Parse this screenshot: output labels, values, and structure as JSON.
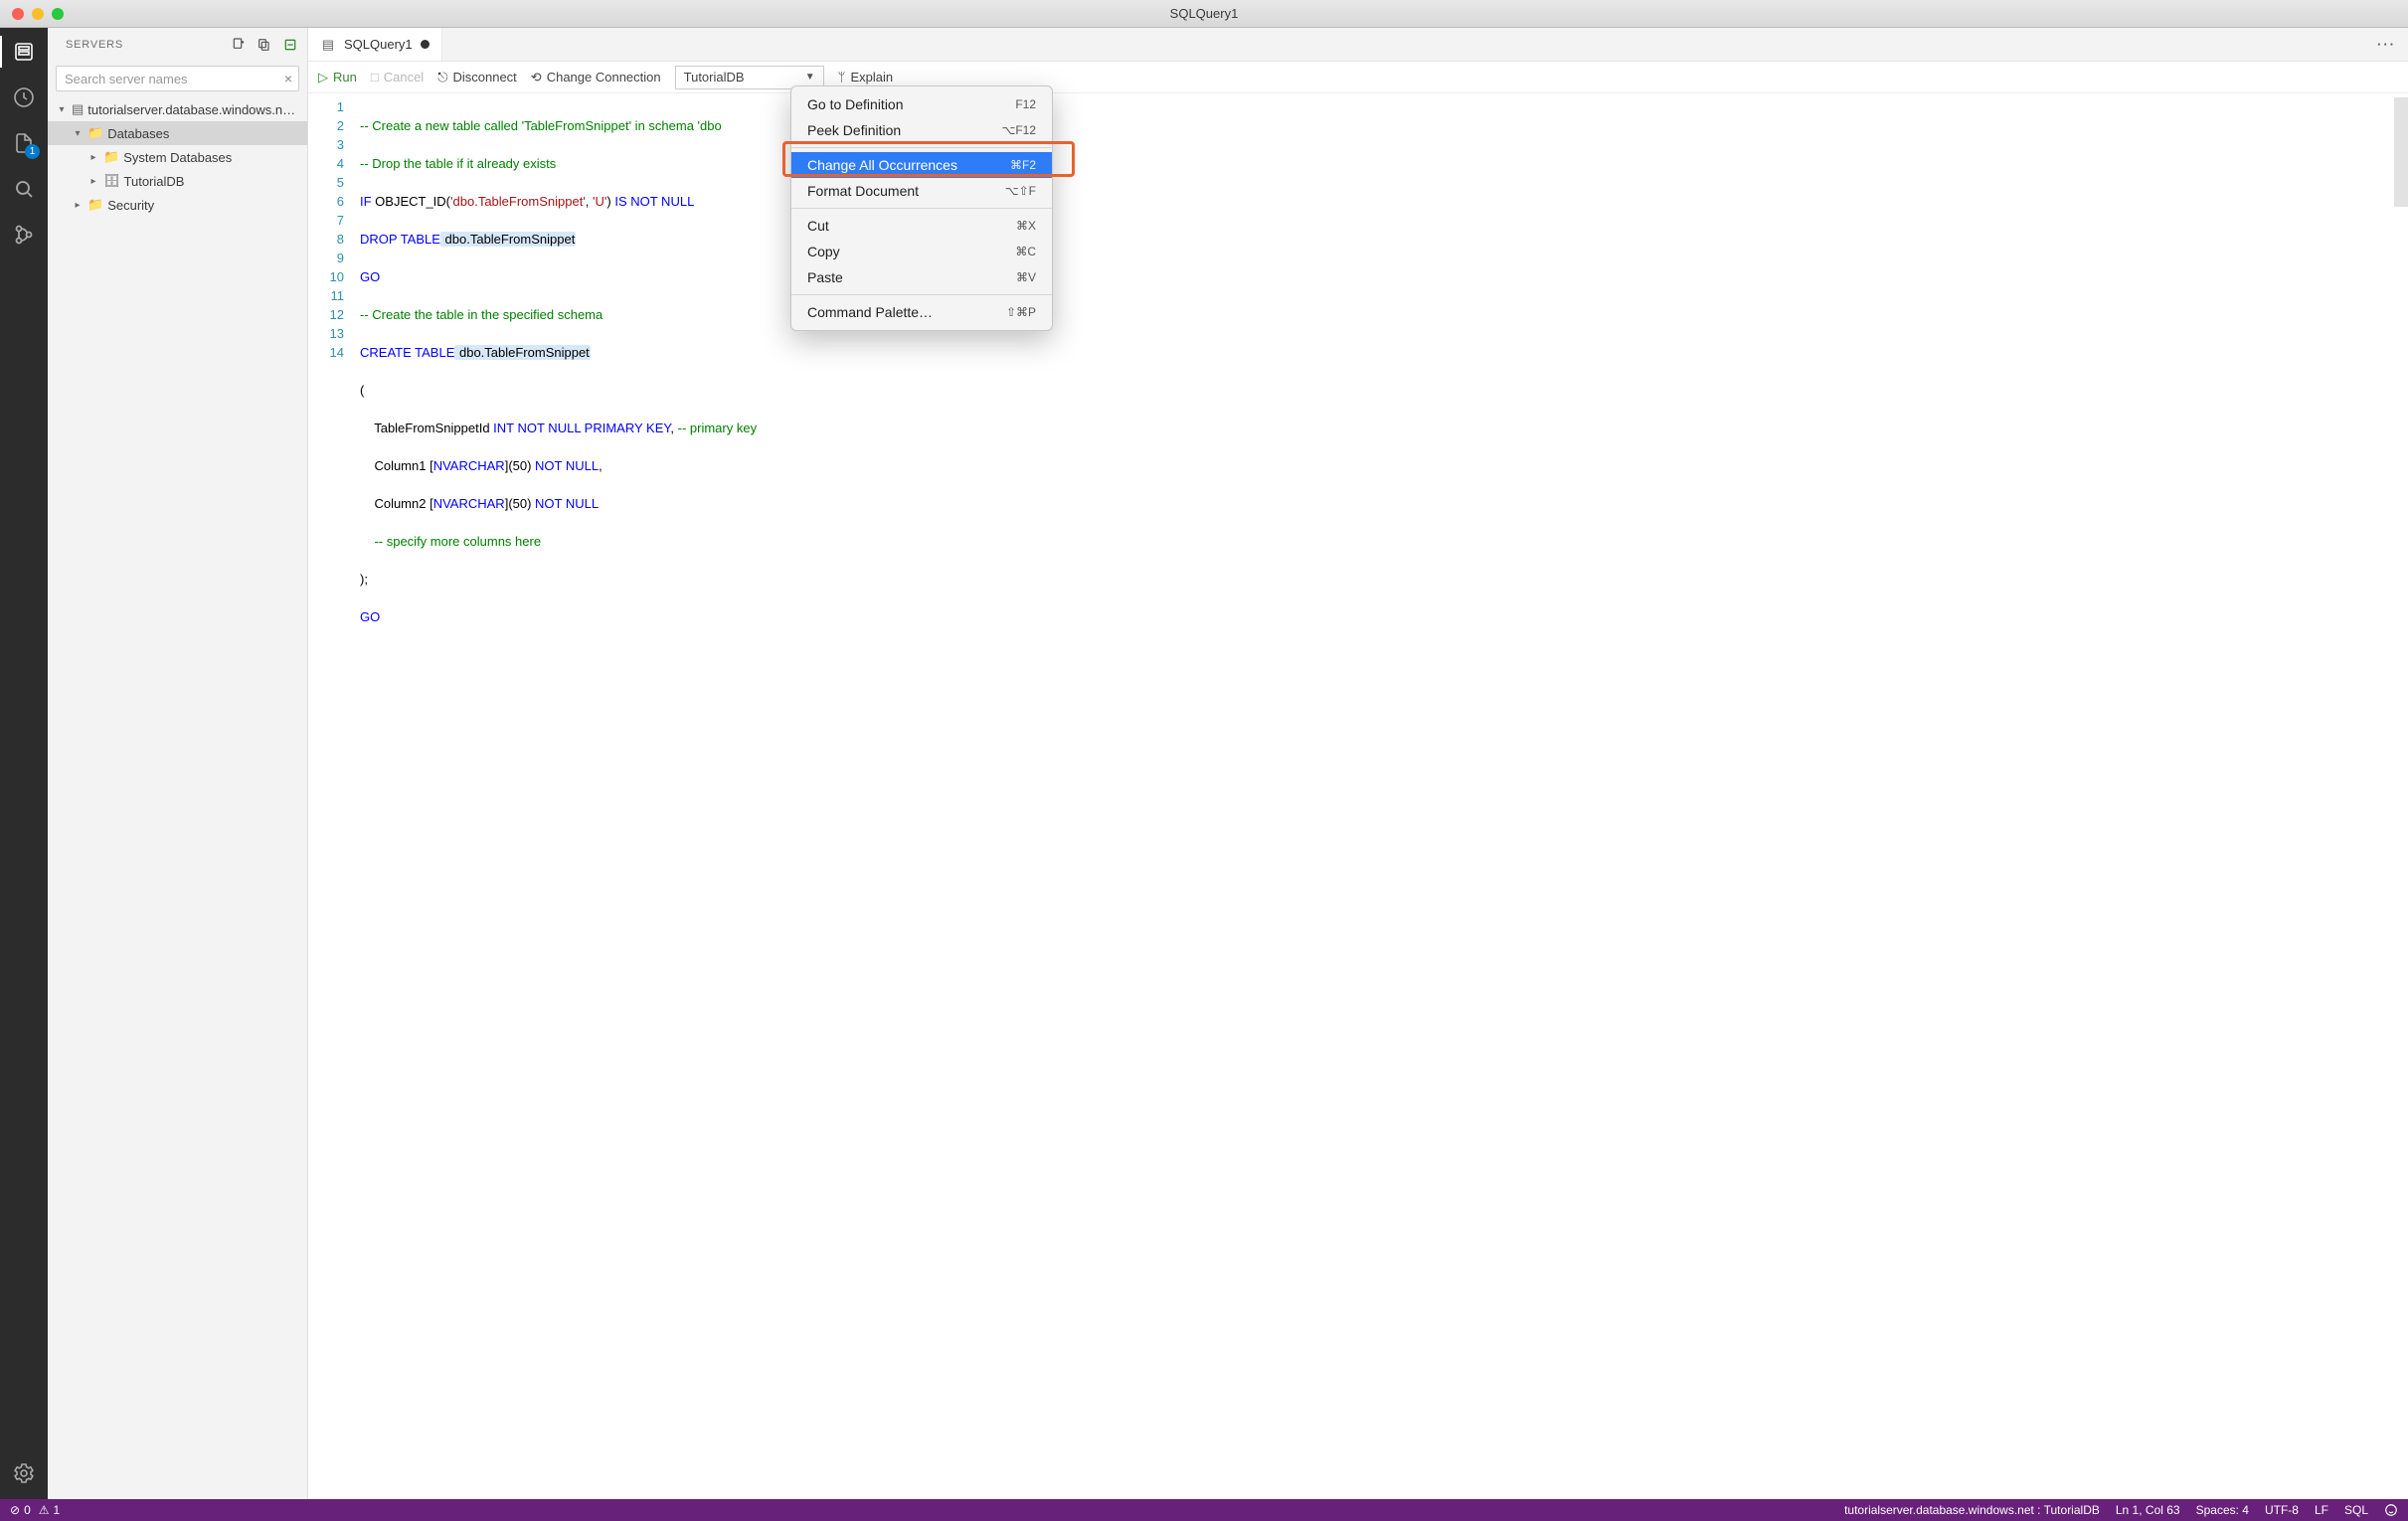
{
  "window": {
    "title": "SQLQuery1"
  },
  "sidebar": {
    "title": "SERVERS",
    "search_placeholder": "Search server names",
    "tree": {
      "server": "tutorialserver.database.windows.n…",
      "databases": "Databases",
      "sysdb": "System Databases",
      "tutorialdb": "TutorialDB",
      "security": "Security"
    }
  },
  "activity": {
    "badge": "1"
  },
  "tabs": {
    "file": "SQLQuery1"
  },
  "toolbar": {
    "run": "Run",
    "cancel": "Cancel",
    "disconnect": "Disconnect",
    "change_conn": "Change Connection",
    "db_selected": "TutorialDB",
    "explain": "Explain"
  },
  "code": {
    "lines": [
      "1",
      "2",
      "3",
      "4",
      "5",
      "6",
      "7",
      "8",
      "9",
      "10",
      "11",
      "12",
      "13",
      "14"
    ],
    "l1_a": "-- Create a new table called ",
    "l1_b": "'TableFromSnippet'",
    "l1_c": " in schema ",
    "l1_d": "'dbo",
    "l2": "-- Drop the table if it already exists",
    "l3_if": "IF",
    "l3_fn": " OBJECT_ID(",
    "l3_s1": "'dbo.TableFromSnippet'",
    "l3_cm": ", ",
    "l3_s2": "'U'",
    "l3_p2": ") ",
    "l3_kw2": "IS NOT NULL",
    "l4_kw": "DROP TABLE",
    "l4_id": " dbo.TableFromSnippet",
    "l5": "GO",
    "l6": "-- Create the table in the specified schema",
    "l7_kw": "CREATE TABLE",
    "l7_id": " dbo.TableFromSnippet",
    "l8": "(",
    "l9_a": "    TableFromSnippetId ",
    "l9_kw": "INT NOT NULL PRIMARY KEY",
    "l9_b": ", ",
    "l9_c": "-- primary key",
    "l10_a": "    Column1 [",
    "l10_kw": "NVARCHAR",
    "l10_b": "](50) ",
    "l10_kw2": "NOT NULL",
    "l10_c": ",",
    "l11_a": "    Column2 [",
    "l11_kw": "NVARCHAR",
    "l11_b": "](50) ",
    "l11_kw2": "NOT NULL",
    "l12": "    -- specify more columns here",
    "l13": ");",
    "l14": "GO"
  },
  "context": {
    "goto": "Go to Definition",
    "goto_sc": "F12",
    "peek": "Peek Definition",
    "peek_sc": "⌥F12",
    "change": "Change All Occurrences",
    "change_sc": "⌘F2",
    "format": "Format Document",
    "format_sc": "⌥⇧F",
    "cut": "Cut",
    "cut_sc": "⌘X",
    "copy": "Copy",
    "copy_sc": "⌘C",
    "paste": "Paste",
    "paste_sc": "⌘V",
    "palette": "Command Palette…",
    "palette_sc": "⇧⌘P"
  },
  "status": {
    "err": "0",
    "warn": "1",
    "conn": "tutorialserver.database.windows.net : TutorialDB",
    "pos": "Ln 1, Col 63",
    "spaces": "Spaces: 4",
    "enc": "UTF-8",
    "eol": "LF",
    "lang": "SQL"
  }
}
